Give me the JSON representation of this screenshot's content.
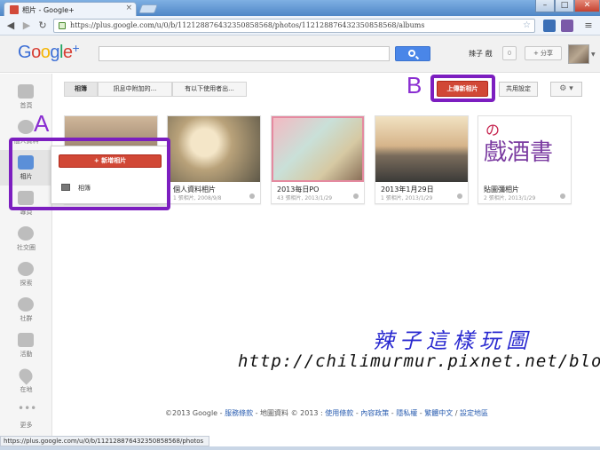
{
  "browser": {
    "tab_title": "相片 - Google+",
    "url": "https://plus.google.com/u/0/b/112128876432350858568/photos/112128876432350858568/albums",
    "status_url": "https://plus.google.com/u/0/b/112128876432350858568/photos"
  },
  "header": {
    "logo": "Google+",
    "username": "辣子 戲",
    "notification_count": "0",
    "share_label": "+ 分享"
  },
  "rail": {
    "items": [
      {
        "label": "首頁"
      },
      {
        "label": "個人資料"
      },
      {
        "label": "相片"
      },
      {
        "label": "專頁"
      },
      {
        "label": "社交圈"
      },
      {
        "label": "探索"
      },
      {
        "label": "社群"
      },
      {
        "label": "活動"
      },
      {
        "label": "在地"
      },
      {
        "label": "更多"
      }
    ]
  },
  "tabs": {
    "albums": "相簿",
    "from_posts": "訊息中附加的...",
    "of_you": "有以下使用者出..."
  },
  "toolbar": {
    "upload": "上傳新相片",
    "shared_settings": "共用設定",
    "gear": "⚙ ▾"
  },
  "albums": [
    {
      "title": "",
      "meta": ""
    },
    {
      "title": "個人資料相片",
      "meta": "1 張相片, 2008/9/8"
    },
    {
      "title": "2013每日PO",
      "meta": "43 張相片, 2013/1/29"
    },
    {
      "title": "2013年1月29日",
      "meta": "1 張相片, 2013/1/29"
    },
    {
      "title": "貼圖彌相片",
      "meta": "2 張相片, 2013/1/29"
    }
  ],
  "popup": {
    "new_photos": "+ 新增相片",
    "album": "相簿"
  },
  "annotations": {
    "a": "A",
    "b": "B"
  },
  "watermark": {
    "title": "辣子這樣玩圖",
    "url": "http://chilimurmur.pixnet.net/blog"
  },
  "footer": {
    "copyright": "©2013 Google - ",
    "terms": "服務條款",
    "map": " - 地圖資料 © 2013 : ",
    "terms_of_use": "使用條款",
    "content_policy": "內容政策",
    "privacy": "隱私權",
    "language": "繁體中文",
    "region": "設定地區"
  },
  "colors": {
    "accent": "#d14836",
    "annotation": "#7c1ec0",
    "link": "#2a5db0"
  }
}
